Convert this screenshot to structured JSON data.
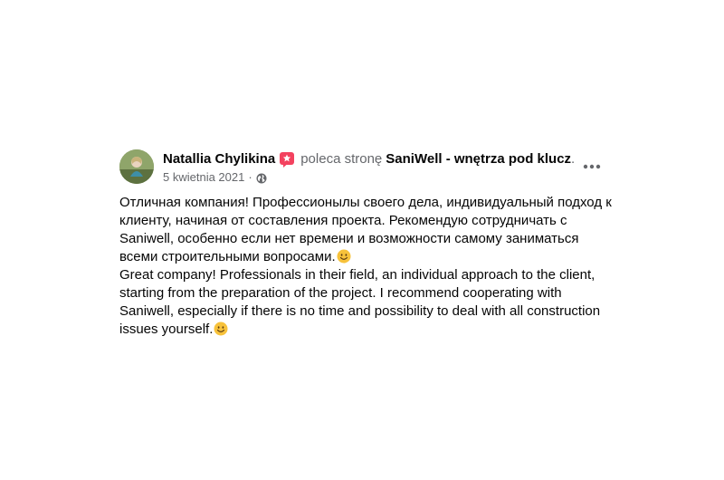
{
  "post": {
    "author": "Natallia Chylikina",
    "action_text": "poleca stronę",
    "page_name": "SaniWell - wnętrza pod klucz",
    "period": ".",
    "date": "5 kwietnia 2021",
    "separator": "·",
    "audience_icon": "globe-icon",
    "badge_icon": "recommend-icon",
    "badge_color": "#f3425f",
    "menu_icon": "more-options-icon",
    "ru_text": "Отличная компания! Профессионылы своего дела, индивидуальный подход к клиенту, начиная от составления проекта. Рекомендую сотрудничать с Saniwell, особенно если нет времени и возможности самому заниматься всеми строительными вопросами.",
    "en_text": "Great company! Professionals in their field, an individual approach to the client, starting from the preparation of the project. I recommend cooperating with Saniwell, especially if there is no time and possibility to deal with all construction issues yourself.",
    "emoji_icon": "smiling-face-emoji"
  }
}
